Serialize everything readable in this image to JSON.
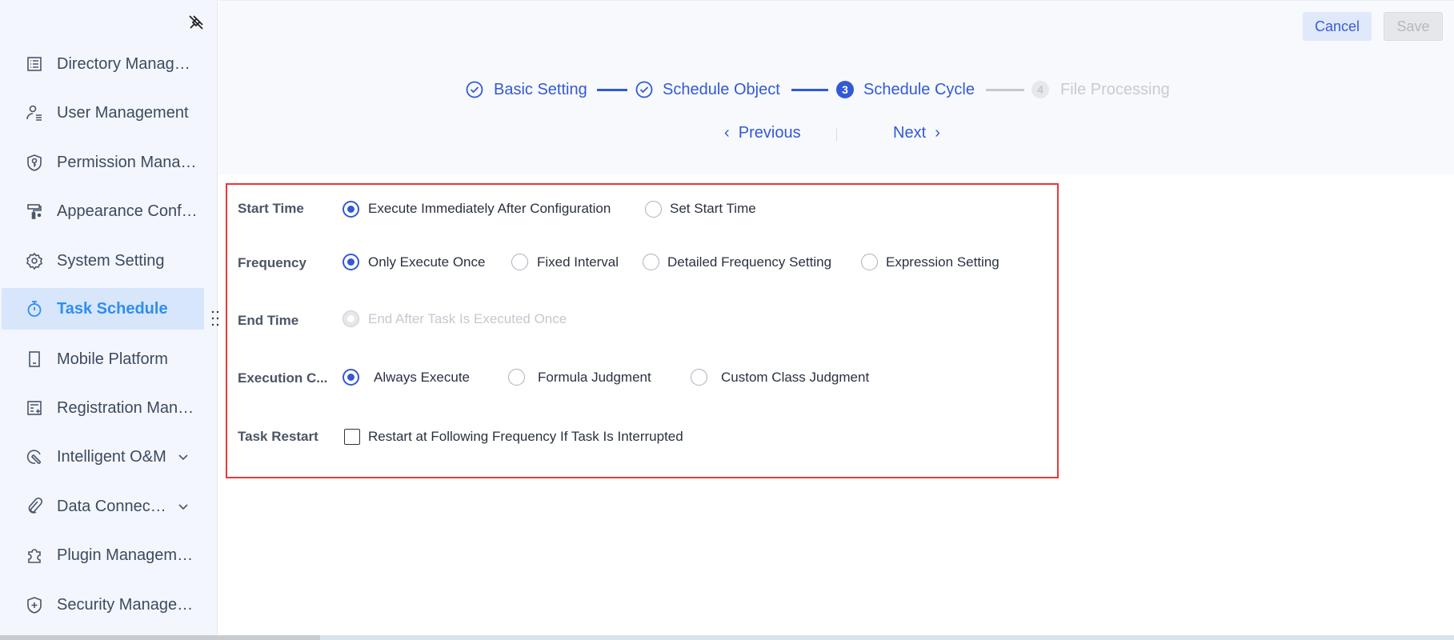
{
  "sidebar": {
    "items": [
      {
        "label": "Directory Manag…",
        "icon": "list-icon"
      },
      {
        "label": "User Management",
        "icon": "user-list-icon"
      },
      {
        "label": "Permission Mana…",
        "icon": "shield-key-icon"
      },
      {
        "label": "Appearance Conf…",
        "icon": "paint-roller-icon"
      },
      {
        "label": "System Setting",
        "icon": "gear-icon"
      },
      {
        "label": "Task Schedule",
        "icon": "stopwatch-icon",
        "active": true
      },
      {
        "label": "Mobile Platform",
        "icon": "mobile-icon"
      },
      {
        "label": "Registration Man…",
        "icon": "form-add-icon"
      },
      {
        "label": "Intelligent O&M",
        "icon": "wrench-icon",
        "expandable": true
      },
      {
        "label": "Data Connec…",
        "icon": "paperclip-icon",
        "expandable": true
      },
      {
        "label": "Plugin Managem…",
        "icon": "puzzle-icon"
      },
      {
        "label": "Security Manage…",
        "icon": "shield-plus-icon"
      }
    ]
  },
  "header": {
    "cancel_label": "Cancel",
    "save_label": "Save",
    "steps": [
      {
        "label": "Basic Setting",
        "status": "done"
      },
      {
        "label": "Schedule Object",
        "status": "done"
      },
      {
        "number": "3",
        "label": "Schedule Cycle",
        "status": "active"
      },
      {
        "number": "4",
        "label": "File Processing",
        "status": "pending"
      }
    ],
    "previous_label": "Previous",
    "next_label": "Next"
  },
  "form": {
    "start_time": {
      "label": "Start Time",
      "options": [
        "Execute Immediately After Configuration",
        "Set Start Time"
      ],
      "selected": 0
    },
    "frequency": {
      "label": "Frequency",
      "options": [
        "Only Execute Once",
        "Fixed Interval",
        "Detailed Frequency Setting",
        "Expression Setting"
      ],
      "selected": 0
    },
    "end_time": {
      "label": "End Time",
      "options": [
        "End After Task Is Executed Once"
      ],
      "disabled": true
    },
    "execution": {
      "label": "Execution C...",
      "options": [
        "Always Execute",
        "Formula Judgment",
        "Custom Class Judgment"
      ],
      "selected": 0
    },
    "task_restart": {
      "label": "Task Restart",
      "checkbox_label": "Restart at Following Frequency If Task Is Interrupted",
      "checked": false
    }
  },
  "colors": {
    "accent": "#3359d6",
    "active_nav": "#2f8ef0",
    "highlight_border": "#ee3636"
  }
}
